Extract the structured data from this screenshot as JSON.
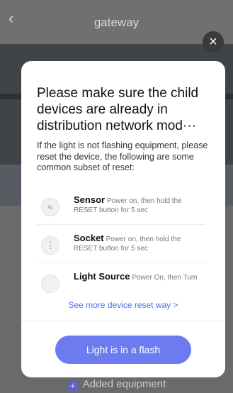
{
  "header": {
    "title": "gateway",
    "back_icon": "chevron-left-icon"
  },
  "footer": {
    "added_label": "Added equipment"
  },
  "dialog": {
    "title": "Please make sure the child devices are already in distribution network mod···",
    "description": "If the light is not flashing equipment, please reset the device, the following are some common subset of reset:",
    "items": [
      {
        "name": "Sensor",
        "instruction": "Power on, then hold the RESET button for 5 sec",
        "icon": "sensor-icon"
      },
      {
        "name": "Socket",
        "instruction": "Power on, then hold the RESET button for 5 sec",
        "icon": "socket-icon"
      },
      {
        "name": "Light Source",
        "instruction": "Power On, then Turn",
        "icon": "bulb-icon"
      }
    ],
    "more_link": "See more device reset way >",
    "primary_button": "Light is in a flash",
    "close_icon": "close-icon"
  },
  "colors": {
    "accent": "#6c7cf0",
    "link": "#4d6fe8",
    "overlay": "#7c7c7c"
  }
}
